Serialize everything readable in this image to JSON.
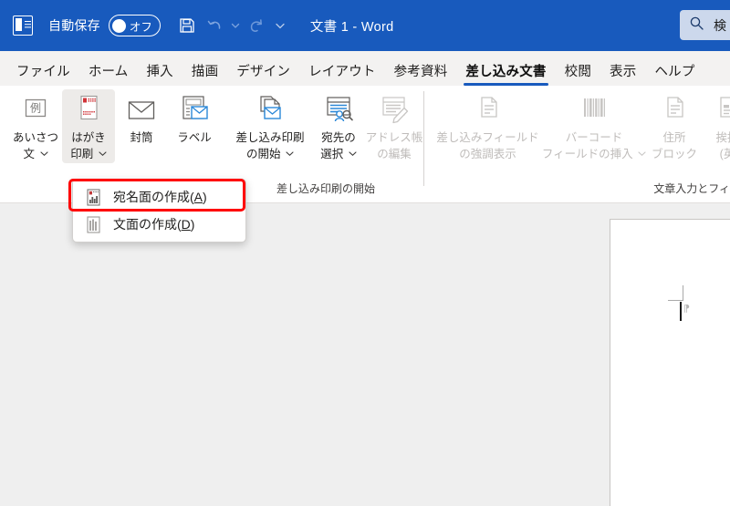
{
  "titlebar": {
    "app_logo_name": "word-logo",
    "autosave_label": "自動保存",
    "autosave_state": "オフ",
    "save_icon": "save-icon",
    "undo_icon": "undo-icon",
    "redo_icon": "redo-icon",
    "qat_more_icon": "chevron-down-icon",
    "title": "文書 1  -  Word",
    "accent_color": "#185ABD"
  },
  "search": {
    "icon": "search-icon",
    "placeholder": "検",
    "background": "#CCD8EC"
  },
  "tabs": [
    {
      "label": "ファイル",
      "active": false
    },
    {
      "label": "ホーム",
      "active": false
    },
    {
      "label": "挿入",
      "active": false
    },
    {
      "label": "描画",
      "active": false
    },
    {
      "label": "デザイン",
      "active": false
    },
    {
      "label": "レイアウト",
      "active": false
    },
    {
      "label": "参考資料",
      "active": false
    },
    {
      "label": "差し込み文書",
      "active": true
    },
    {
      "label": "校閲",
      "active": false
    },
    {
      "label": "表示",
      "active": false
    },
    {
      "label": "ヘルプ",
      "active": false
    }
  ],
  "tab_underline_color": "#185ABD",
  "ribbon": {
    "groups": [
      {
        "label": "",
        "buttons": [
          {
            "name": "greeting-text-button",
            "icon": "example-box-icon",
            "line1": "あいさつ",
            "line2": "文",
            "has_chevron": true,
            "disabled": false,
            "pressed": false
          },
          {
            "name": "postcard-print-button",
            "icon": "postcard-icon",
            "line1": "はがき",
            "line2": "印刷",
            "has_chevron": true,
            "disabled": false,
            "pressed": true
          },
          {
            "name": "envelope-button",
            "icon": "envelope-icon",
            "line1": "封筒",
            "line2": "",
            "has_chevron": false,
            "disabled": false,
            "pressed": false
          },
          {
            "name": "label-button",
            "icon": "label-icon",
            "line1": "ラベル",
            "line2": "",
            "has_chevron": false,
            "disabled": false,
            "pressed": false
          }
        ]
      },
      {
        "label": "差し込み印刷の開始",
        "buttons": [
          {
            "name": "start-mail-merge-button",
            "icon": "mail-merge-icon",
            "line1": "差し込み印刷",
            "line2": "の開始",
            "has_chevron": true,
            "disabled": false,
            "pressed": false
          },
          {
            "name": "select-recipients-button",
            "icon": "select-recipients-icon",
            "line1": "宛先の",
            "line2": "選択",
            "has_chevron": true,
            "disabled": false,
            "pressed": false
          },
          {
            "name": "edit-recipient-list-button",
            "icon": "edit-list-icon",
            "line1": "アドレス帳",
            "line2": "の編集",
            "has_chevron": false,
            "disabled": true,
            "pressed": false
          }
        ]
      },
      {
        "label": "文章入力とフィー",
        "buttons": [
          {
            "name": "highlight-merge-fields-button",
            "icon": "document-icon",
            "line1": "差し込みフィールド",
            "line2": "の強調表示",
            "has_chevron": false,
            "disabled": true,
            "pressed": false
          },
          {
            "name": "insert-barcode-field-button",
            "icon": "barcode-icon",
            "line1": "バーコード",
            "line2": "フィールドの挿入",
            "has_chevron": true,
            "disabled": true,
            "pressed": false
          },
          {
            "name": "address-block-button",
            "icon": "document-icon",
            "line1": "住所",
            "line2": "ブロック",
            "has_chevron": false,
            "disabled": true,
            "pressed": false
          },
          {
            "name": "greeting-line-button",
            "icon": "document-icon",
            "line1": "挨拶",
            "line2": "(英",
            "has_chevron": false,
            "disabled": true,
            "pressed": false
          }
        ]
      }
    ]
  },
  "dropdown": {
    "items": [
      {
        "name": "create-address-side",
        "icon": "address-side-icon",
        "pre": "宛名面の作成(",
        "key": "A",
        "post": ")",
        "highlighted": true
      },
      {
        "name": "create-message-side",
        "icon": "message-side-icon",
        "pre": "文面の作成(",
        "key": "D",
        "post": ")",
        "highlighted": false
      }
    ],
    "highlight_color": "#FF0000"
  },
  "document": {
    "page_background": "#FFFFFF",
    "canvas_background": "#EFEFEF",
    "margin_mark_name": "margin-corner-mark",
    "caret_name": "text-cursor",
    "paragraph_mark": "⁋"
  }
}
